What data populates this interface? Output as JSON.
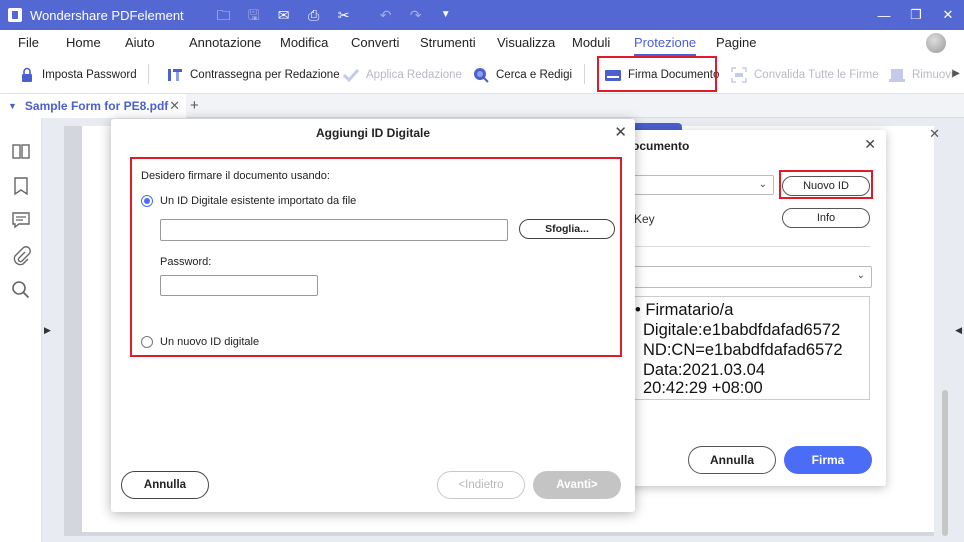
{
  "app": {
    "title": "Wondershare PDFelement",
    "window_controls": [
      "—",
      "❐",
      "✕"
    ]
  },
  "quick_access": [
    {
      "icon": "folder-icon",
      "glyph": "🗀"
    },
    {
      "icon": "save-icon",
      "glyph": "🖫",
      "disabled": true
    },
    {
      "icon": "mail-icon",
      "glyph": "✉"
    },
    {
      "icon": "print-icon",
      "glyph": "⎙"
    },
    {
      "icon": "scissors-icon",
      "glyph": "✂"
    },
    {
      "icon": "undo-icon",
      "glyph": "↶",
      "disabled": true
    },
    {
      "icon": "redo-icon",
      "glyph": "↷",
      "disabled": true
    },
    {
      "icon": "dropdown-icon",
      "glyph": "▼"
    }
  ],
  "menu": {
    "items": [
      "File",
      "Home",
      "Aiuto",
      "Annotazione",
      "Modifica",
      "Converti",
      "Strumenti",
      "Visualizza",
      "Moduli",
      "Protezione",
      "Pagine"
    ],
    "active": "Protezione"
  },
  "toolbar": {
    "imposta_password": "Imposta Password",
    "contrassegna": "Contrassegna per Redazione",
    "applica_redazione": "Applica Redazione",
    "cerca_redigi": "Cerca e Redigi",
    "firma_documento": "Firma Documento",
    "convalida_firme": "Convalida Tutte le Firme",
    "rimuovi": "Rimuovi"
  },
  "tabs": {
    "document_tab": "Sample Form for PE8.pdf",
    "close": "✕",
    "add": "+"
  },
  "sign_dialog": {
    "title_partial": "ocumento",
    "close": "✕",
    "nuovo_id": "Nuovo ID",
    "info": "Info",
    "key_label": "Key",
    "signature_lines": [
      "• Firmatario/a",
      "Digitale:e1babdfdafad6572",
      "ND:CN=e1babdfdafad6572",
      "Data:2021.03.04",
      " 20:42:29 +08:00"
    ],
    "annulla": "Annulla",
    "firma": "Firma"
  },
  "digital_id_dialog": {
    "title": "Aggiungi ID Digitale",
    "close": "✕",
    "question": "Desidero firmare il documento usando:",
    "option_existing": "Un ID Digitale esistente importato da file",
    "file_path_value": "",
    "browse_button": "Sfoglia...",
    "password_label": "Password:",
    "password_value": "",
    "option_new": "Un nuovo ID digitale",
    "selected_option": "existing",
    "cancel_button": "Annulla",
    "back_button": "<Indietro",
    "next_button": "Avanti>"
  },
  "colors": {
    "titlebar": "#5468d4",
    "accent": "#4a6cf7",
    "highlight": "#e01b2b"
  }
}
